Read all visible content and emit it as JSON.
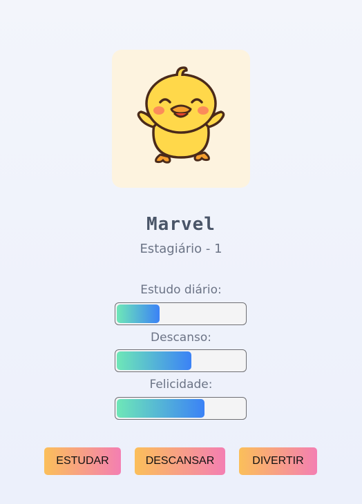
{
  "pet": {
    "name": "Marvel",
    "level": "Estagiário - 1"
  },
  "stats": [
    {
      "label": "Estudo diário:",
      "value": 0.33
    },
    {
      "label": "Descanso:",
      "value": 0.57
    },
    {
      "label": "Felicidade:",
      "value": 0.67
    }
  ],
  "actions": {
    "study": "ESTUDAR",
    "rest": "DESCANSAR",
    "fun": "DIVERTIR"
  },
  "colors": {
    "bar_start": "#6ee7b7",
    "bar_end": "#3b82f6",
    "button_start": "#fbbf5a",
    "button_end": "#f47fb2",
    "card": "#fdf3df"
  },
  "icons": {
    "avatar": "duck-icon"
  }
}
